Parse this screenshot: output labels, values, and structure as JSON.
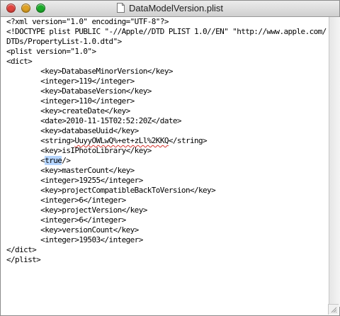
{
  "window": {
    "title": "DataModelVersion.plist"
  },
  "editor": {
    "lines": [
      "<?xml version=\"1.0\" encoding=\"UTF-8\"?>",
      "<!DOCTYPE plist PUBLIC \"-//Apple//DTD PLIST 1.0//EN\" \"http://www.apple.com/",
      "DTDs/PropertyList-1.0.dtd\">",
      "<plist version=\"1.0\">",
      "<dict>",
      "        <key>DatabaseMinorVersion</key>",
      "        <integer>119</integer>",
      "        <key>DatabaseVersion</key>",
      "        <integer>110</integer>",
      "        <key>createDate</key>",
      "        <date>2010-11-15T02:52:20Z</date>",
      "        <key>databaseUuid</key>",
      "        <string>UuyyOWLwQ%+et+zLl%2KKQ</string>",
      "        <key>isIPhotoLibrary</key>",
      "        <true/>",
      "        <key>masterCount</key>",
      "        <integer>19255</integer>",
      "        <key>projectCompatibleBackToVersion</key>",
      "        <integer>6</integer>",
      "        <key>projectVersion</key>",
      "        <integer>6</integer>",
      "        <key>versionCount</key>",
      "        <integer>19503</integer>",
      "</dict>",
      "</plist>"
    ],
    "spellcheck_word": "UuyyOWLwQ%+et+zLl%2KKQ",
    "selected_text": "true",
    "selected_line": 14
  },
  "colors": {
    "selection": "#b5d5ff",
    "close": "#e0443e",
    "minimize": "#dea123",
    "zoom": "#1aab29"
  }
}
